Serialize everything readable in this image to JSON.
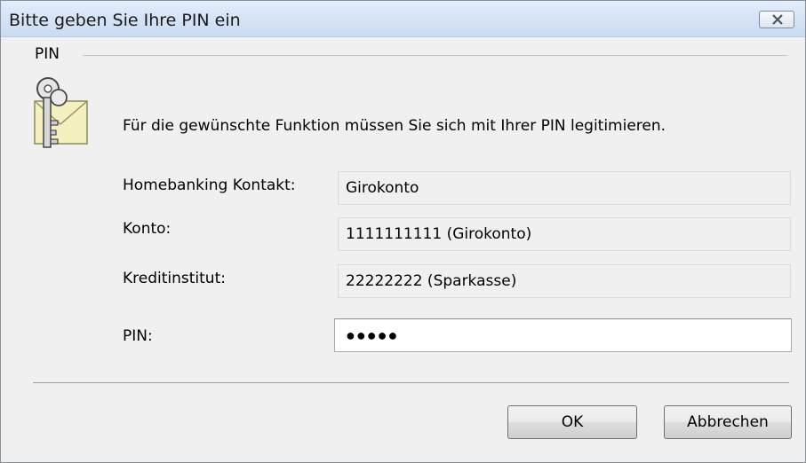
{
  "window": {
    "title": "Bitte geben Sie Ihre PIN ein",
    "close_icon": "close-icon"
  },
  "group": {
    "label": "PIN",
    "icon": "key-envelope-icon"
  },
  "message": "Für die gewünschte Funktion müssen Sie sich mit Ihrer PIN legitimieren.",
  "fields": {
    "contact": {
      "label": "Homebanking Kontakt:",
      "value": "Girokonto"
    },
    "account": {
      "label": "Konto:",
      "value": "1111111111 (Girokonto)"
    },
    "bank": {
      "label": "Kreditinstitut:",
      "value": "22222222  (Sparkasse)"
    },
    "pin": {
      "label": "PIN:",
      "value": "●●●●●"
    }
  },
  "buttons": {
    "ok": "OK",
    "cancel": "Abbrechen"
  }
}
